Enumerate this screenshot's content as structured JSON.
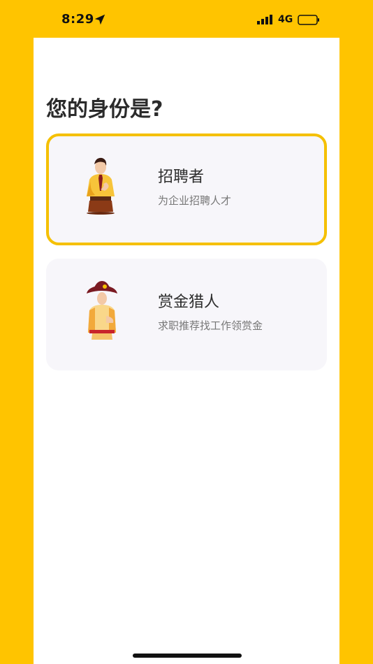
{
  "status_bar": {
    "time": "8:29",
    "network": "4G"
  },
  "page": {
    "title": "您的身份是?"
  },
  "roles": [
    {
      "title": "招聘者",
      "subtitle": "为企业招聘人才",
      "selected": true,
      "icon": "recruiter-avatar-icon"
    },
    {
      "title": "赏金猎人",
      "subtitle": "求职推荐找工作领赏金",
      "selected": false,
      "icon": "bounty-hunter-avatar-icon"
    }
  ],
  "colors": {
    "accent": "#FFC400",
    "selected_border": "#F5C000",
    "card_bg": "#F7F6FA"
  }
}
